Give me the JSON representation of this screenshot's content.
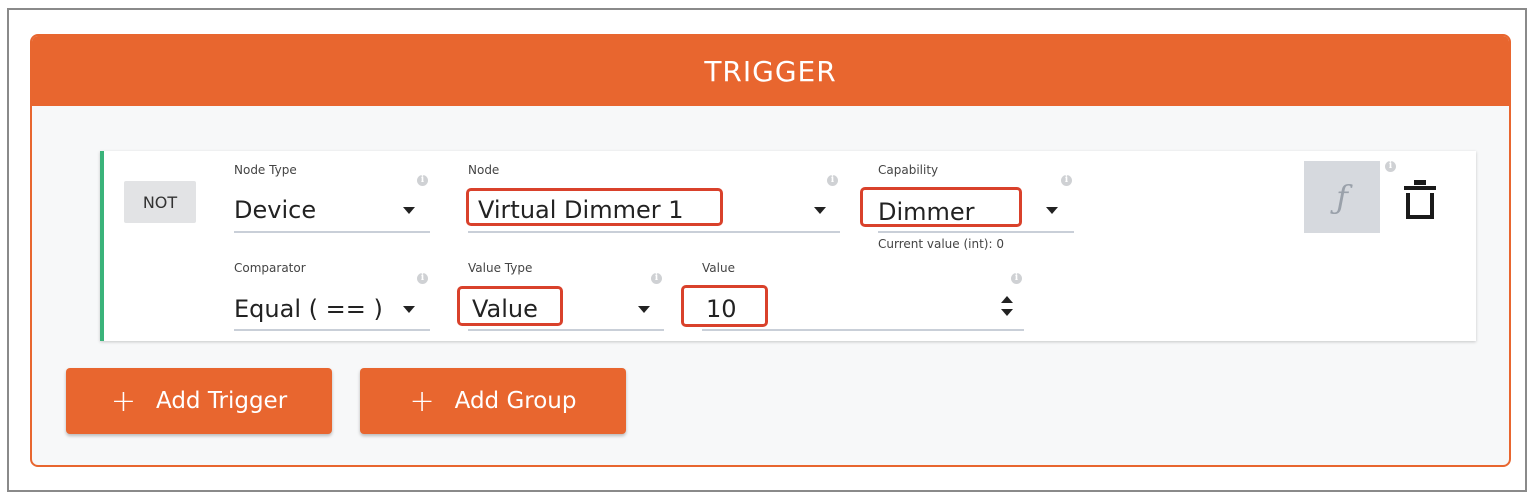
{
  "panel": {
    "title": "TRIGGER",
    "accent_color": "#e8662f",
    "condition_border_color": "#3ab37a"
  },
  "condition": {
    "not_label": "NOT",
    "node_type": {
      "label": "Node Type",
      "value": "Device"
    },
    "node": {
      "label": "Node",
      "value": "Virtual Dimmer 1"
    },
    "capability": {
      "label": "Capability",
      "value": "Dimmer",
      "hint": "Current value (int): 0"
    },
    "comparator": {
      "label": "Comparator",
      "value": "Equal ( == )"
    },
    "value_type": {
      "label": "Value Type",
      "value": "Value"
    },
    "value": {
      "label": "Value",
      "value": "10"
    },
    "function_icon": "ƒ",
    "info_icon": "i",
    "delete_icon": "trash-icon"
  },
  "buttons": {
    "add_trigger": {
      "icon": "+",
      "label": "Add Trigger"
    },
    "add_group": {
      "icon": "+",
      "label": "Add Group"
    }
  },
  "highlight_color": "#d9412b"
}
